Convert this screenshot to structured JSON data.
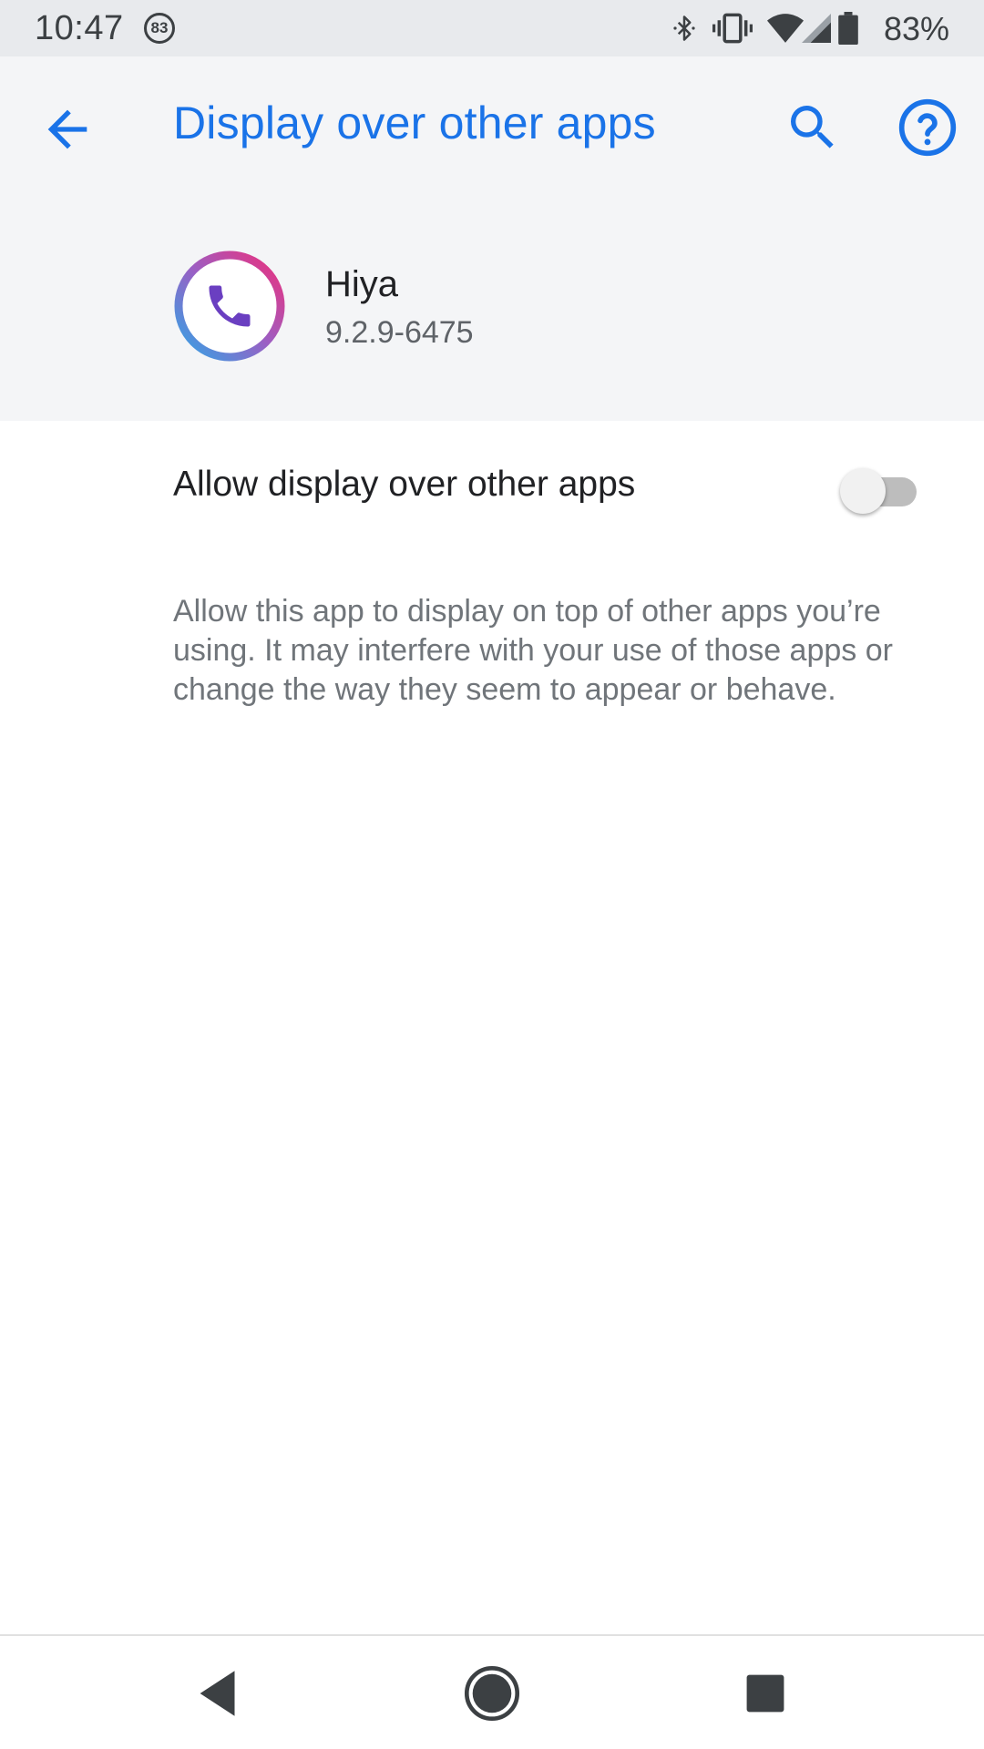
{
  "status_bar": {
    "time": "10:47",
    "notification_count": "83",
    "battery_percent": "83%",
    "icons": [
      "bluetooth-icon",
      "vibrate-icon",
      "wifi-icon",
      "cell-signal-icon",
      "battery-icon"
    ]
  },
  "app_bar": {
    "title": "Display over other apps",
    "back_icon": "arrow-back-icon",
    "search_icon": "search-icon",
    "help_icon": "help-icon"
  },
  "app": {
    "name": "Hiya",
    "version": "9.2.9-6475",
    "icon": "hiya-phone-icon"
  },
  "setting": {
    "label": "Allow display over other apps",
    "enabled": false,
    "description": "Allow this app to display on top of other apps you’re using. It may interfere with your use of those apps or change the way they seem to appear or behave."
  },
  "nav_bar": {
    "icons": [
      "nav-back-icon",
      "nav-home-icon",
      "nav-recents-icon"
    ]
  },
  "colors": {
    "accent": "#1a73e8",
    "status_bar_bg": "#e8eaed",
    "header_bg": "#f4f5f7",
    "text_primary": "#202124",
    "text_secondary": "#70757a"
  }
}
